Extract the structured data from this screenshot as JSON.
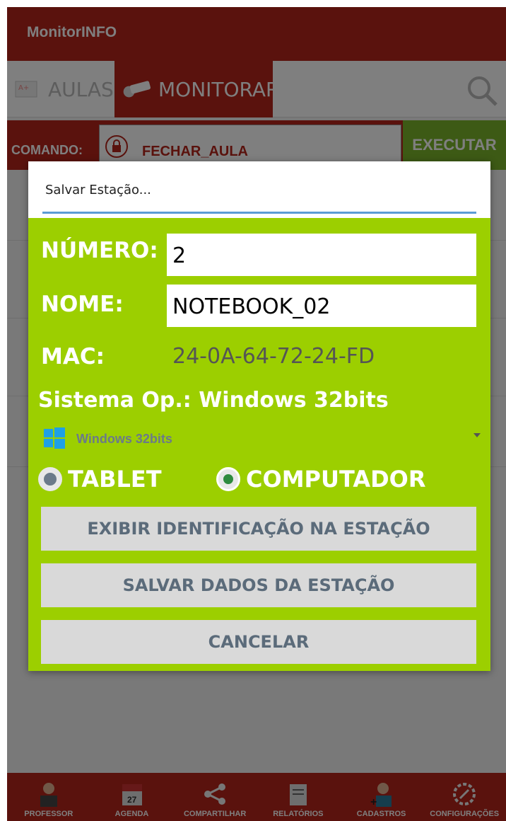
{
  "app": {
    "title": "MonitorINFO"
  },
  "tabs": [
    {
      "label": "AULAS",
      "icon": "lesson-icon"
    },
    {
      "label": "MONITORAR",
      "icon": "camera-icon"
    }
  ],
  "command": {
    "label": "COMANDO:",
    "value": "FECHAR_AULA",
    "execute_label": "EXECUTAR"
  },
  "dialog": {
    "title": "Salvar Estação...",
    "numero_label": "NÚMERO:",
    "numero_value": "2",
    "nome_label": "NOME:",
    "nome_value": "NOTEBOOK_02",
    "mac_label": "MAC:",
    "mac_value": "24-0A-64-72-24-FD",
    "so_line": "Sistema Op.: Windows 32bits",
    "so_selected": "Windows 32bits",
    "radio_tablet": "TABLET",
    "radio_computador": "COMPUTADOR",
    "radio_selected": "COMPUTADOR",
    "btn_exibir": "EXIBIR IDENTIFICAÇÃO NA ESTAÇÃO",
    "btn_salvar": "SALVAR DADOS DA ESTAÇÃO",
    "btn_cancelar": "CANCELAR"
  },
  "bottom_nav": [
    {
      "label": "PROFESSOR",
      "icon": "teacher-icon"
    },
    {
      "label": "AGENDA",
      "icon": "calendar-icon"
    },
    {
      "label": "COMPARTILHAR",
      "icon": "share-icon"
    },
    {
      "label": "RELATÓRIOS",
      "icon": "report-icon"
    },
    {
      "label": "CADASTROS",
      "icon": "register-user-icon"
    },
    {
      "label": "CONFIGURAÇÕES",
      "icon": "settings-icon"
    }
  ],
  "colors": {
    "primary": "#b5251b",
    "accent_green": "#9ccf00",
    "execute_green": "#7bb52a",
    "dialog_line": "#5b9bd5"
  }
}
